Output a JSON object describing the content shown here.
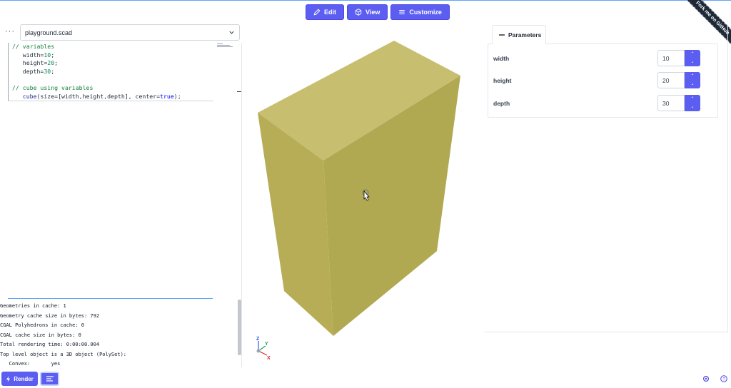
{
  "toolbar": {
    "edit_label": "Edit",
    "view_label": "View",
    "customize_label": "Customize"
  },
  "ribbon": {
    "label": "Fork me on GitHub"
  },
  "editor": {
    "more_label": "···",
    "file_name": "playground.scad",
    "code_lines": [
      "// variables",
      "   width=10;",
      "   height=20;",
      "   depth=30;",
      "",
      "// cube using variables",
      "   cube(size=[width,height,depth], center=true);"
    ]
  },
  "console": {
    "lines": [
      "Geometries in cache: 1",
      "Geometry cache size in bytes: 792",
      "CGAL Polyhedrons in cache: 0",
      "CGAL cache size in bytes: 0",
      "Total rendering time: 0:00:00.004",
      "Top level object is a 3D object (PolySet):",
      "   Convex:       yes"
    ]
  },
  "bottom": {
    "render_label": "Render"
  },
  "viewer": {
    "model_color": "#c4ba6a",
    "axis_labels": {
      "z": "Z",
      "y": "Y",
      "x": "X"
    }
  },
  "parameters": {
    "tab_label": "Parameters",
    "items": [
      {
        "name": "width",
        "value": "10"
      },
      {
        "name": "height",
        "value": "20"
      },
      {
        "name": "depth",
        "value": "30"
      }
    ]
  },
  "colors": {
    "accent": "#5b5ef0",
    "top_face": "#c7be70",
    "left_face": "#b8ad57",
    "right_face": "#b1a852"
  }
}
